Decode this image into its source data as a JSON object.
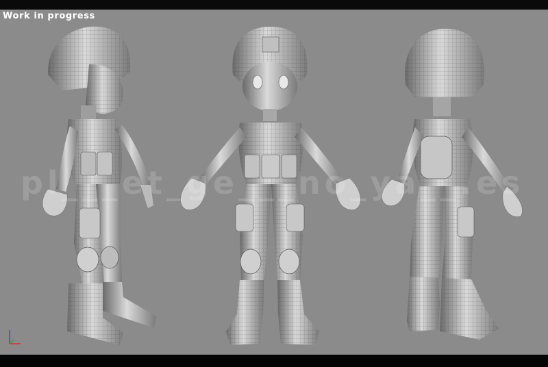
{
  "viewport": {
    "label": "Work in progress",
    "background_color": "#8b8b8b",
    "watermark": "pl___et_ge___no_ya__.es",
    "figures": [
      {
        "view": "side",
        "icon": "character-side-view-icon"
      },
      {
        "view": "front",
        "icon": "character-front-view-icon"
      },
      {
        "view": "back",
        "icon": "character-back-view-icon"
      }
    ],
    "axis_gizmo": {
      "icon": "axis-gizmo-icon",
      "x_color": "#d03030",
      "y_color": "#3050d0"
    }
  }
}
